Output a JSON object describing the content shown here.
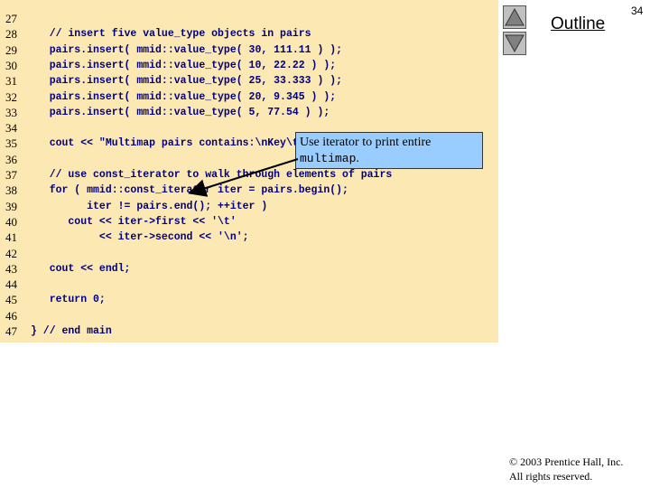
{
  "slide": {
    "page_number": "34",
    "outline_label": "Outline",
    "copyright_line1": "© 2003 Prentice Hall, Inc.",
    "copyright_line2": "All rights reserved."
  },
  "code": {
    "lines": [
      {
        "num": "27",
        "text": ""
      },
      {
        "num": "28",
        "text": "   // insert five value_type objects in pairs"
      },
      {
        "num": "29",
        "text": "   pairs.insert( mmid::value_type( 30, 111.11 ) );"
      },
      {
        "num": "30",
        "text": "   pairs.insert( mmid::value_type( 10, 22.22 ) );"
      },
      {
        "num": "31",
        "text": "   pairs.insert( mmid::value_type( 25, 33.333 ) );"
      },
      {
        "num": "32",
        "text": "   pairs.insert( mmid::value_type( 20, 9.345 ) );"
      },
      {
        "num": "33",
        "text": "   pairs.insert( mmid::value_type( 5, 77.54 ) );"
      },
      {
        "num": "34",
        "text": ""
      },
      {
        "num": "35",
        "text": "   cout << \"Multimap pairs contains:\\nKey\\tValue\\n\";"
      },
      {
        "num": "36",
        "text": ""
      },
      {
        "num": "37",
        "text": "   // use const_iterator to walk through elements of pairs"
      },
      {
        "num": "38",
        "text": "   for ( mmid::const_iterator iter = pairs.begin();"
      },
      {
        "num": "39",
        "text": "         iter != pairs.end(); ++iter )"
      },
      {
        "num": "40",
        "text": "      cout << iter->first << '\\t'"
      },
      {
        "num": "41",
        "text": "           << iter->second << '\\n';"
      },
      {
        "num": "42",
        "text": ""
      },
      {
        "num": "43",
        "text": "   cout << endl;"
      },
      {
        "num": "44",
        "text": ""
      },
      {
        "num": "45",
        "text": "   return 0;"
      },
      {
        "num": "46",
        "text": ""
      },
      {
        "num": "47",
        "text": "} // end main"
      }
    ]
  },
  "callout": {
    "text_before": "Use iterator to print entire ",
    "code_word": "multimap",
    "text_after": "."
  }
}
